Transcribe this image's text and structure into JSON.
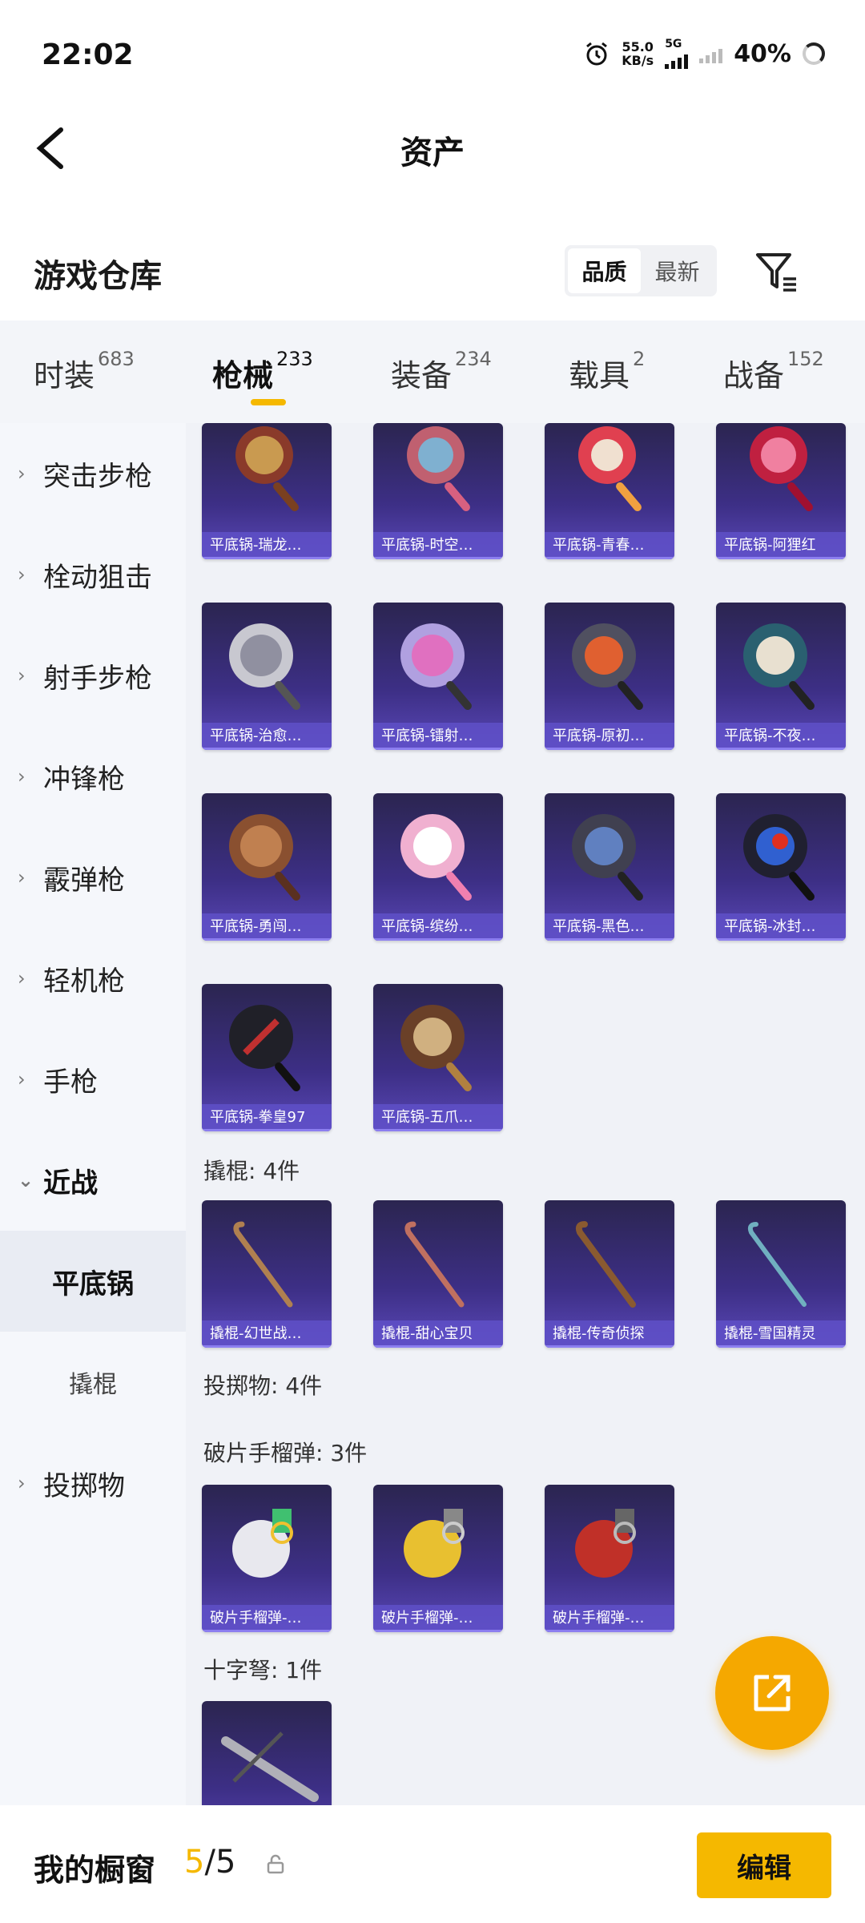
{
  "status": {
    "time": "22:02",
    "net_speed_top": "55.0",
    "net_speed_bottom": "KB/s",
    "network": "5G",
    "battery": "40%"
  },
  "header": {
    "title": "资产"
  },
  "section": {
    "title": "游戏仓库",
    "sort_options": [
      "品质",
      "最新"
    ],
    "sort_active": "品质"
  },
  "tabs": [
    {
      "label": "时装",
      "count": "683"
    },
    {
      "label": "枪械",
      "count": "233"
    },
    {
      "label": "装备",
      "count": "234"
    },
    {
      "label": "载具",
      "count": "2"
    },
    {
      "label": "战备",
      "count": "152"
    }
  ],
  "sidebar": {
    "items": [
      "突击步枪",
      "栓动狙击",
      "射手步枪",
      "冲锋枪",
      "霰弹枪",
      "轻机枪",
      "手枪",
      "近战"
    ],
    "sub_items": [
      "平底锅",
      "撬棍"
    ],
    "last_item": "投掷物"
  },
  "content": {
    "pans": [
      "平底锅-瑞龙…",
      "平底锅-时空…",
      "平底锅-青春…",
      "平底锅-阿狸红",
      "平底锅-治愈…",
      "平底锅-镭射…",
      "平底锅-原初…",
      "平底锅-不夜…",
      "平底锅-勇闯…",
      "平底锅-缤纷…",
      "平底锅-黑色…",
      "平底锅-冰封…",
      "平底锅-拳皇97",
      "平底锅-五爪…"
    ],
    "crowbar_header": "撬棍: 4件",
    "crowbars": [
      "撬棍-幻世战…",
      "撬棍-甜心宝贝",
      "撬棍-传奇侦探",
      "撬棍-雪国精灵"
    ],
    "throwable_header": "投掷物: 4件",
    "grenade_header": "破片手榴弹: 3件",
    "grenades": [
      "破片手榴弹-…",
      "破片手榴弹-…",
      "破片手榴弹-…"
    ],
    "crossbow_header": "十字弩: 1件"
  },
  "bottom": {
    "title": "我的橱窗",
    "count_current": "5",
    "count_sep": "/",
    "count_total": "5",
    "edit_label": "编辑"
  },
  "colors": {
    "accent": "#f5b800",
    "card_bg": "#3d2f86"
  }
}
